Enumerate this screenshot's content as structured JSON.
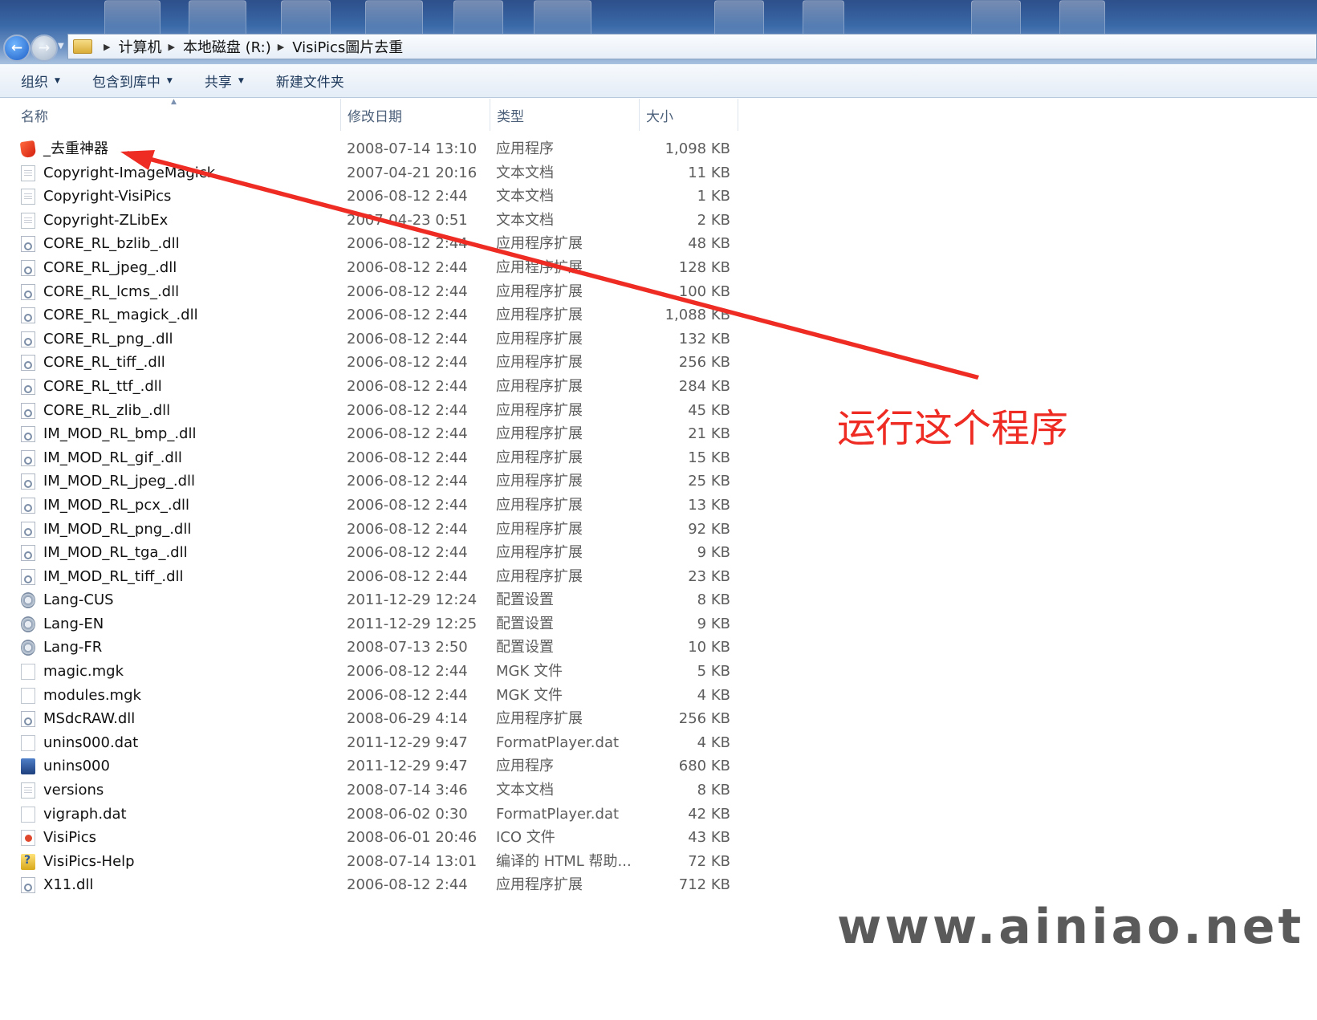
{
  "breadcrumb": {
    "items": [
      "计算机",
      "本地磁盘 (R:)",
      "VisiPics圖片去重"
    ]
  },
  "toolbar": {
    "organize": "组织",
    "include_library": "包含到库中",
    "share": "共享",
    "new_folder": "新建文件夹"
  },
  "columns": {
    "name": "名称",
    "date": "修改日期",
    "type": "类型",
    "size": "大小"
  },
  "files": [
    {
      "name": "_去重神器",
      "date": "2008-07-14 13:10",
      "type": "应用程序",
      "size": "1,098 KB",
      "icon": "app-icon"
    },
    {
      "name": "Copyright-ImageMagick",
      "date": "2007-04-21 20:16",
      "type": "文本文档",
      "size": "11 KB",
      "icon": "text-file-icon"
    },
    {
      "name": "Copyright-VisiPics",
      "date": "2006-08-12 2:44",
      "type": "文本文档",
      "size": "1 KB",
      "icon": "text-file-icon"
    },
    {
      "name": "Copyright-ZLibEx",
      "date": "2007-04-23 0:51",
      "type": "文本文档",
      "size": "2 KB",
      "icon": "text-file-icon"
    },
    {
      "name": "CORE_RL_bzlib_.dll",
      "date": "2006-08-12 2:44",
      "type": "应用程序扩展",
      "size": "48 KB",
      "icon": "dll-icon"
    },
    {
      "name": "CORE_RL_jpeg_.dll",
      "date": "2006-08-12 2:44",
      "type": "应用程序扩展",
      "size": "128 KB",
      "icon": "dll-icon"
    },
    {
      "name": "CORE_RL_lcms_.dll",
      "date": "2006-08-12 2:44",
      "type": "应用程序扩展",
      "size": "100 KB",
      "icon": "dll-icon"
    },
    {
      "name": "CORE_RL_magick_.dll",
      "date": "2006-08-12 2:44",
      "type": "应用程序扩展",
      "size": "1,088 KB",
      "icon": "dll-icon"
    },
    {
      "name": "CORE_RL_png_.dll",
      "date": "2006-08-12 2:44",
      "type": "应用程序扩展",
      "size": "132 KB",
      "icon": "dll-icon"
    },
    {
      "name": "CORE_RL_tiff_.dll",
      "date": "2006-08-12 2:44",
      "type": "应用程序扩展",
      "size": "256 KB",
      "icon": "dll-icon"
    },
    {
      "name": "CORE_RL_ttf_.dll",
      "date": "2006-08-12 2:44",
      "type": "应用程序扩展",
      "size": "284 KB",
      "icon": "dll-icon"
    },
    {
      "name": "CORE_RL_zlib_.dll",
      "date": "2006-08-12 2:44",
      "type": "应用程序扩展",
      "size": "45 KB",
      "icon": "dll-icon"
    },
    {
      "name": "IM_MOD_RL_bmp_.dll",
      "date": "2006-08-12 2:44",
      "type": "应用程序扩展",
      "size": "21 KB",
      "icon": "dll-icon"
    },
    {
      "name": "IM_MOD_RL_gif_.dll",
      "date": "2006-08-12 2:44",
      "type": "应用程序扩展",
      "size": "15 KB",
      "icon": "dll-icon"
    },
    {
      "name": "IM_MOD_RL_jpeg_.dll",
      "date": "2006-08-12 2:44",
      "type": "应用程序扩展",
      "size": "25 KB",
      "icon": "dll-icon"
    },
    {
      "name": "IM_MOD_RL_pcx_.dll",
      "date": "2006-08-12 2:44",
      "type": "应用程序扩展",
      "size": "13 KB",
      "icon": "dll-icon"
    },
    {
      "name": "IM_MOD_RL_png_.dll",
      "date": "2006-08-12 2:44",
      "type": "应用程序扩展",
      "size": "92 KB",
      "icon": "dll-icon"
    },
    {
      "name": "IM_MOD_RL_tga_.dll",
      "date": "2006-08-12 2:44",
      "type": "应用程序扩展",
      "size": "9 KB",
      "icon": "dll-icon"
    },
    {
      "name": "IM_MOD_RL_tiff_.dll",
      "date": "2006-08-12 2:44",
      "type": "应用程序扩展",
      "size": "23 KB",
      "icon": "dll-icon"
    },
    {
      "name": "Lang-CUS",
      "date": "2011-12-29 12:24",
      "type": "配置设置",
      "size": "8 KB",
      "icon": "config-file-icon"
    },
    {
      "name": "Lang-EN",
      "date": "2011-12-29 12:25",
      "type": "配置设置",
      "size": "9 KB",
      "icon": "config-file-icon"
    },
    {
      "name": "Lang-FR",
      "date": "2008-07-13 2:50",
      "type": "配置设置",
      "size": "10 KB",
      "icon": "config-file-icon"
    },
    {
      "name": "magic.mgk",
      "date": "2006-08-12 2:44",
      "type": "MGK 文件",
      "size": "5 KB",
      "icon": "blank-file-icon"
    },
    {
      "name": "modules.mgk",
      "date": "2006-08-12 2:44",
      "type": "MGK 文件",
      "size": "4 KB",
      "icon": "blank-file-icon"
    },
    {
      "name": "MSdcRAW.dll",
      "date": "2008-06-29 4:14",
      "type": "应用程序扩展",
      "size": "256 KB",
      "icon": "dll-icon"
    },
    {
      "name": "unins000.dat",
      "date": "2011-12-29 9:47",
      "type": "FormatPlayer.dat",
      "size": "4 KB",
      "icon": "blank-file-icon"
    },
    {
      "name": "unins000",
      "date": "2011-12-29 9:47",
      "type": "应用程序",
      "size": "680 KB",
      "icon": "setup-icon"
    },
    {
      "name": "versions",
      "date": "2008-07-14 3:46",
      "type": "文本文档",
      "size": "8 KB",
      "icon": "text-file-icon"
    },
    {
      "name": "vigraph.dat",
      "date": "2008-06-02 0:30",
      "type": "FormatPlayer.dat",
      "size": "42 KB",
      "icon": "blank-file-icon"
    },
    {
      "name": "VisiPics",
      "date": "2008-06-01 20:46",
      "type": "ICO 文件",
      "size": "43 KB",
      "icon": "ico-file-icon"
    },
    {
      "name": "VisiPics-Help",
      "date": "2008-07-14 13:01",
      "type": "编译的 HTML 帮助...",
      "size": "72 KB",
      "icon": "help-file-icon"
    },
    {
      "name": "X11.dll",
      "date": "2006-08-12 2:44",
      "type": "应用程序扩展",
      "size": "712 KB",
      "icon": "dll-icon"
    }
  ],
  "annotation": {
    "text": "运行这个程序",
    "color": "#ee2c24"
  },
  "watermark": "www.ainiao.net"
}
